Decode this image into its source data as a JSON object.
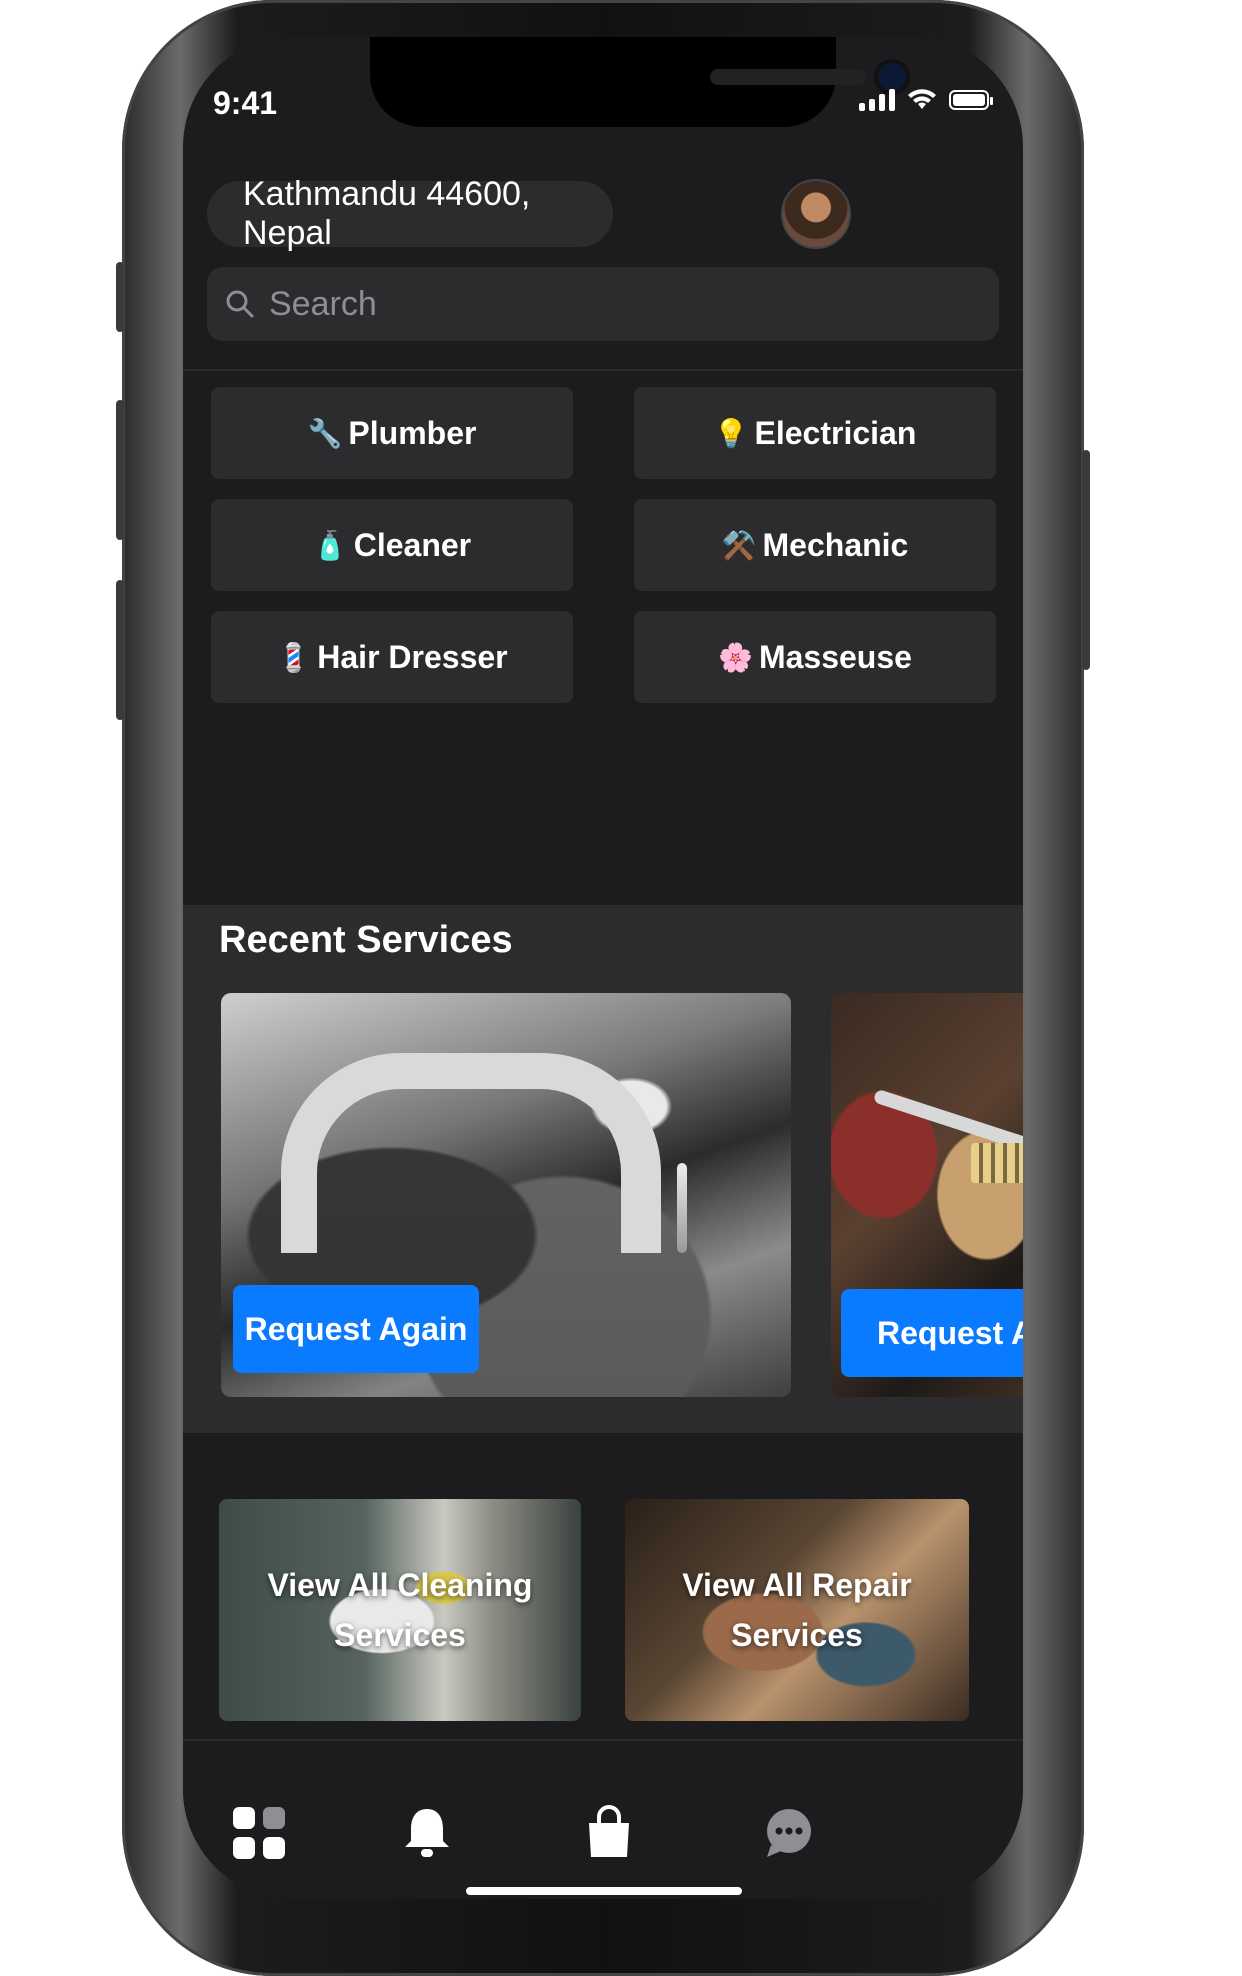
{
  "status_bar": {
    "time": "9:41"
  },
  "header": {
    "location": "Kathmandu 44600, Nepal"
  },
  "search": {
    "placeholder": "Search"
  },
  "categories": [
    {
      "emoji": "🔧",
      "label": "Plumber"
    },
    {
      "emoji": "💡",
      "label": "Electrician"
    },
    {
      "emoji": "🧴",
      "label": "Cleaner"
    },
    {
      "emoji": "⚒️",
      "label": "Mechanic"
    },
    {
      "emoji": "💈",
      "label": "Hair Dresser"
    },
    {
      "emoji": "🌸",
      "label": "Masseuse"
    }
  ],
  "recent": {
    "title": "Recent Services",
    "cards": [
      {
        "button_label": "Request Again"
      },
      {
        "button_label": "Request A"
      }
    ]
  },
  "promos": [
    {
      "label": "View All Cleaning Services"
    },
    {
      "label": "View All Repair Services"
    }
  ],
  "tabbar": {
    "items": [
      "grid-icon",
      "bell-icon",
      "bag-icon",
      "chat-icon"
    ]
  },
  "colors": {
    "background": "#1c1c1e",
    "surface": "#2c2c2e",
    "accent": "#0a7aff",
    "text": "#ffffff",
    "placeholder": "#8e8e93"
  }
}
